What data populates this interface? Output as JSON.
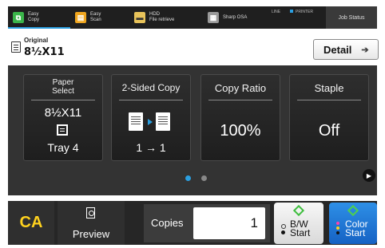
{
  "topbar": {
    "modes": [
      {
        "name": "easy-copy",
        "line1": "Easy",
        "line2": "Copy",
        "icon_color": "#3bb54a",
        "active": true
      },
      {
        "name": "easy-scan",
        "line1": "Easy",
        "line2": "Scan",
        "icon_color": "#f0a61e",
        "active": false
      },
      {
        "name": "hdd-file-retrieve",
        "line1": "HDD",
        "line2": "File retrieve",
        "icon_color": "#e8c35a",
        "active": false
      },
      {
        "name": "sharp-osa",
        "line1": "Sharp OSA",
        "line2": "",
        "icon_color": "#9a9a9a",
        "active": false
      }
    ],
    "line_indicator": "LINE",
    "printer_indicator": "PRINTER",
    "job_status": "Job Status"
  },
  "original": {
    "label": "Original",
    "size": "8½X11"
  },
  "detail_button": {
    "label": "Detail",
    "arrow": "➔"
  },
  "tiles": [
    {
      "title": "Paper Select",
      "value": "8½X11",
      "tray": "Tray 4"
    },
    {
      "title": "2-Sided Copy",
      "value": "1 → 1"
    },
    {
      "title": "Copy Ratio",
      "value": "100%"
    },
    {
      "title": "Staple",
      "value": "Off"
    }
  ],
  "pager": {
    "current_page": 1,
    "total_pages": 2
  },
  "bottom": {
    "clear_all": "CA",
    "preview": "Preview",
    "copies_label": "Copies",
    "copies_value": "1",
    "bw_start_line1": "B/W",
    "bw_start_line2": "Start",
    "color_start_line1": "Color",
    "color_start_line2": "Start"
  },
  "colors": {
    "accent_blue": "#2b9fe0",
    "ca_yellow": "#ffd21e",
    "color_start_blue": "#1f78d6",
    "start_lamp_green": "#3fbe3f"
  }
}
